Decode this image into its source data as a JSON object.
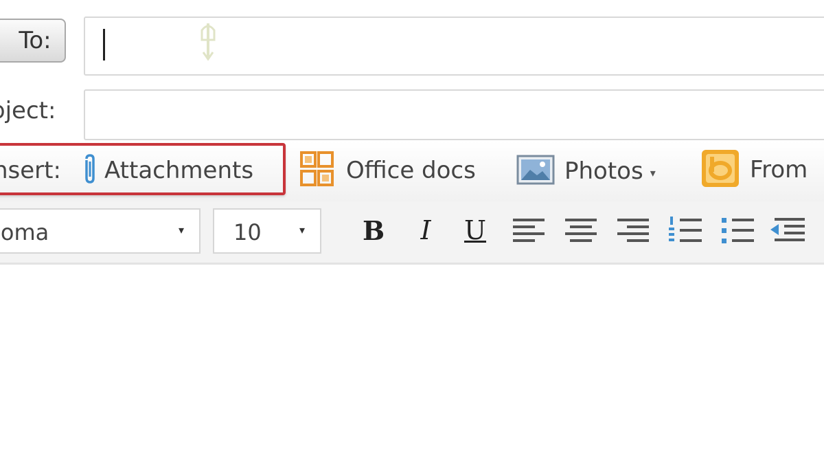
{
  "compose": {
    "to_label": "To:",
    "subject_label": "bject:",
    "insert": {
      "label": "nsert:",
      "attachments": "Attachments",
      "office_docs": "Office docs",
      "photos": "Photos",
      "photos_arrow": "▾",
      "from": "From"
    },
    "format": {
      "font": "ioma",
      "size": "10",
      "dropdown_arrow": "▾",
      "bold": "B",
      "italic": "I",
      "underline": "U"
    }
  },
  "colors": {
    "highlight": "#c8353b",
    "attachment_icon": "#3f8fd0",
    "office_icon": "#e8912c",
    "bing_icon": "#f0a92a"
  },
  "icons": [
    "paperclip-icon",
    "office-docs-icon",
    "photos-icon",
    "from-bing-icon",
    "align-left-icon",
    "align-center-icon",
    "align-right-icon",
    "numbered-list-icon",
    "bulleted-list-icon",
    "outdent-icon"
  ]
}
